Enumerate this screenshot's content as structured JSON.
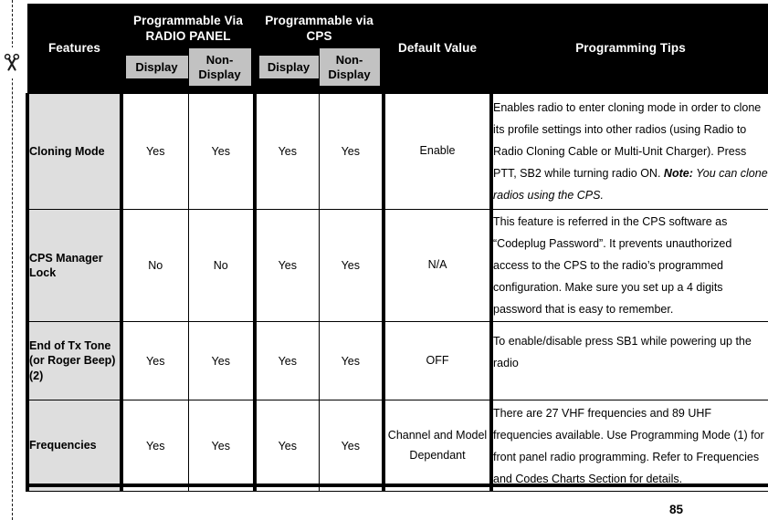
{
  "page": {
    "page_number": "85",
    "cut_line_icon": "scissors-icon"
  },
  "table": {
    "headers": {
      "features": "Features",
      "radio_panel": "Programmable Via RADIO PANEL",
      "cps": "Programmable via CPS",
      "default_value": "Default Value",
      "programming_tips": "Programming Tips"
    },
    "subheaders": {
      "radio_panel_display": "Display",
      "radio_panel_non_display": "Non-Display",
      "cps_display": "Display",
      "cps_non_display": "Non-Display"
    },
    "rows": [
      {
        "feature": "Cloning Mode",
        "rp_display": "Yes",
        "rp_non_display": "Yes",
        "cps_display": "Yes",
        "cps_non_display": "Yes",
        "default_value": "Enable",
        "tips": "Enables radio to enter cloning mode in order to clone its profile settings into other radios (using Radio to Radio Cloning Cable or Multi-Unit Charger). Press PTT, SB2 while turning radio ON.",
        "note_label": "Note:",
        "note_text": " You can clone radios using the CPS."
      },
      {
        "feature": "CPS Manager Lock",
        "rp_display": "No",
        "rp_non_display": "No",
        "cps_display": "Yes",
        "cps_non_display": "Yes",
        "default_value": "N/A",
        "tips": "This feature is referred in the CPS software as “Codeplug Password”. It prevents unauthorized access to the CPS to the radio’s programmed configuration. Make sure you set up a 4 digits password that is easy to remember.",
        "note_label": "",
        "note_text": ""
      },
      {
        "feature": "End of Tx Tone (or Roger Beep) (2)",
        "rp_display": "Yes",
        "rp_non_display": "Yes",
        "cps_display": "Yes",
        "cps_non_display": "Yes",
        "default_value": "OFF",
        "tips": "To enable/disable press SB1 while powering up the radio",
        "note_label": "",
        "note_text": ""
      },
      {
        "feature": "Frequencies",
        "rp_display": "Yes",
        "rp_non_display": "Yes",
        "cps_display": "Yes",
        "cps_non_display": "Yes",
        "default_value": "Channel and Model Dependant",
        "tips": "There are 27 VHF frequencies and 89 UHF frequencies available. Use Programming Mode (1) for front panel radio programming. Refer to Frequencies and Codes Charts Section for details.",
        "note_label": "",
        "note_text": ""
      }
    ]
  },
  "colors": {
    "header_background": "#000000",
    "header_text": "#ffffff",
    "subheader_background": "#c2c2c2",
    "feature_cell_background": "#dedede",
    "border": "#000000"
  }
}
